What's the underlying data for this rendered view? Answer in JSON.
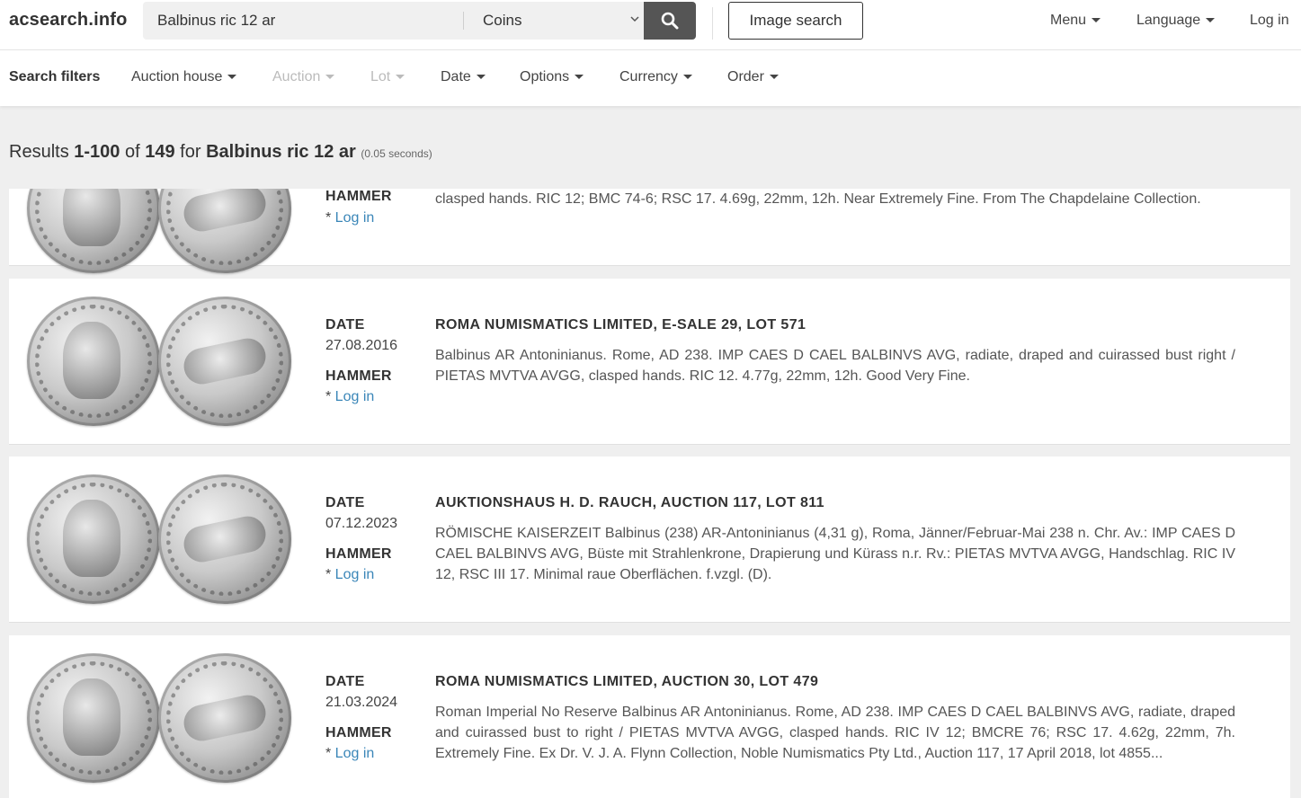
{
  "navbar": {
    "brand": "acsearch.info",
    "search_value": "Balbinus ric 12 ar",
    "category": "Coins",
    "image_search": "Image search",
    "menu": "Menu",
    "language": "Language",
    "login": "Log in"
  },
  "filters": {
    "title": "Search filters",
    "auction_house": "Auction house",
    "auction": "Auction",
    "lot": "Lot",
    "date": "Date",
    "options": "Options",
    "currency": "Currency",
    "order": "Order"
  },
  "results": {
    "prefix": "Results",
    "range": "1-100",
    "of": "of",
    "total": "149",
    "for": "for",
    "query": "Balbinus ric 12 ar",
    "time": "(0.05 seconds)"
  },
  "labels": {
    "date": "DATE",
    "hammer": "HAMMER",
    "login_prefix": "* ",
    "login": "Log in"
  },
  "items": [
    {
      "description": "clasped hands. RIC 12; BMC 74-6; RSC 17. 4.69g, 22mm, 12h. Near Extremely Fine. From The Chapdelaine Collection."
    },
    {
      "date": "27.08.2016",
      "title": "ROMA NUMISMATICS LIMITED, E-SALE 29, LOT 571",
      "description": "Balbinus AR Antoninianus. Rome, AD 238. IMP CAES D CAEL BALBINVS AVG, radiate, draped and cuirassed bust right / PIETAS MVTVA AVGG, clasped hands. RIC 12. 4.77g, 22mm, 12h. Good Very Fine."
    },
    {
      "date": "07.12.2023",
      "title": "AUKTIONSHAUS H. D. RAUCH, AUCTION 117, LOT 811",
      "description": "RÖMISCHE KAISERZEIT Balbinus (238) AR-Antoninianus (4,31 g), Roma, Jänner/Februar-Mai 238 n. Chr. Av.: IMP CAES D CAEL BALBINVS AVG, Büste mit Strahlenkrone, Drapierung und Kürass n.r. Rv.: PIETAS MVTVA AVGG, Handschlag. RIC IV 12, RSC III 17. Minimal raue Oberflächen. f.vzgl. (D)."
    },
    {
      "date": "21.03.2024",
      "title": "ROMA NUMISMATICS LIMITED, AUCTION 30, LOT 479",
      "description": "Roman Imperial No Reserve Balbinus AR Antoninianus. Rome, AD 238. IMP CAES D CAEL BALBINVS AVG, radiate, draped and cuirassed bust to right / PIETAS MVTVA AVGG, clasped hands. RIC IV 12; BMCRE 76; RSC 17. 4.62g, 22mm, 7h. Extremely Fine. Ex Dr. V. J. A. Flynn Collection, Noble Numismatics Pty Ltd., Auction 117, 17 April 2018, lot 4855..."
    }
  ]
}
